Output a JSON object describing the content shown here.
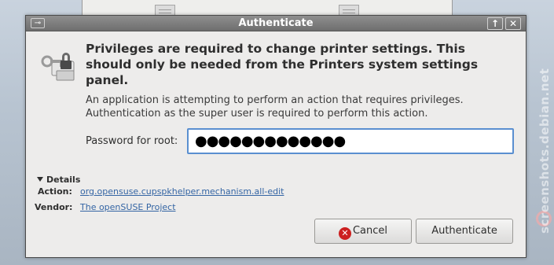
{
  "dialog": {
    "title": "Authenticate",
    "heading": "Privileges are required to change printer settings. This should only be needed from the Printers system settings panel.",
    "description": "An application is attempting to perform an action that requires privileges. Authentication as the super user is required to perform this action.",
    "password_label": "Password for root:",
    "password_value": "●●●●●●●●●●●●●",
    "details": {
      "toggle_label": "Details",
      "action_label": "Action:",
      "action_value": "org.opensuse.cupspkhelper.mechanism.all-edit",
      "vendor_label": "Vendor:",
      "vendor_value": "The openSUSE Project"
    },
    "buttons": {
      "cancel": "Cancel",
      "authenticate": "Authenticate"
    },
    "titlebar": {
      "up_glyph": "↑",
      "close_glyph": "✕"
    }
  },
  "watermark": "screenshots.debian.net",
  "colors": {
    "link": "#3465a4",
    "focus_border": "#5a8fd0",
    "cancel_icon": "#cc2020"
  }
}
